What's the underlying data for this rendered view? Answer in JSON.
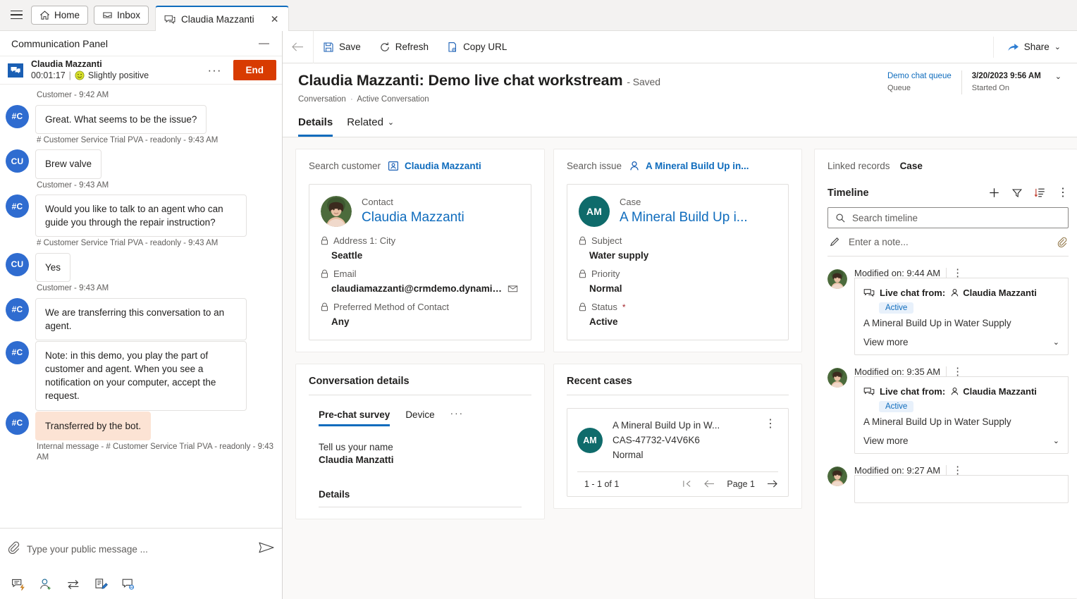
{
  "tabstrip": {
    "menu_icon": "hamburger-icon",
    "tabs": [
      {
        "label": "Home",
        "icon": "home-icon"
      },
      {
        "label": "Inbox",
        "icon": "inbox-icon"
      }
    ],
    "active_tab": {
      "label": "Claudia Mazzanti",
      "icon": "chat-icon",
      "close": "✕"
    }
  },
  "comm_panel": {
    "title": "Communication Panel",
    "minimize": "—",
    "conversation": {
      "name": "Claudia Mazzanti",
      "timer": "00:01:17",
      "separator": "|",
      "sentiment": "Slightly positive",
      "more": "···",
      "end_label": "End"
    },
    "messages": [
      {
        "kind": "stamp",
        "text": "Customer - 9:42 AM"
      },
      {
        "kind": "msg",
        "initials": "#C",
        "text": "Great. What seems to be the issue?",
        "internal": false
      },
      {
        "kind": "stamp",
        "text": "# Customer Service Trial PVA - readonly - 9:43 AM"
      },
      {
        "kind": "msg",
        "initials": "CU",
        "text": "Brew valve",
        "internal": false
      },
      {
        "kind": "stamp",
        "text": "Customer - 9:43 AM"
      },
      {
        "kind": "msg",
        "initials": "#C",
        "text": "Would you like to talk to an agent who can guide you through the repair instruction?",
        "internal": false
      },
      {
        "kind": "stamp",
        "text": "# Customer Service Trial PVA - readonly - 9:43 AM"
      },
      {
        "kind": "msg",
        "initials": "CU",
        "text": "Yes",
        "internal": false
      },
      {
        "kind": "stamp",
        "text": "Customer - 9:43 AM"
      },
      {
        "kind": "msg",
        "initials": "#C",
        "text": "We are transferring this conversation to an agent.",
        "internal": false
      },
      {
        "kind": "msg",
        "initials": "#C",
        "text": "Note: in this demo, you play the part of customer and agent. When you see a notification on your computer, accept the request.",
        "internal": false
      },
      {
        "kind": "msg",
        "initials": "#C",
        "text": "Transferred by the bot.",
        "internal": true
      },
      {
        "kind": "stamp",
        "text": "Internal message - # Customer Service Trial PVA - readonly - 9:43 AM"
      }
    ],
    "composer": {
      "attach_icon": "paperclip-icon",
      "placeholder": "Type your public message ...",
      "value": "",
      "send_icon": "send-icon"
    },
    "tools": [
      "quick-reply-icon",
      "add-agent-icon",
      "transfer-icon",
      "notes-icon",
      "consult-icon"
    ]
  },
  "command_bar": {
    "back_icon": "back-arrow-icon",
    "items": [
      {
        "label": "Save",
        "icon": "save-icon"
      },
      {
        "label": "Refresh",
        "icon": "refresh-icon"
      },
      {
        "label": "Copy URL",
        "icon": "copy-url-icon"
      }
    ],
    "share": {
      "label": "Share",
      "icon": "share-icon",
      "chevron": "⌄"
    }
  },
  "record_header": {
    "title": "Claudia Mazzanti: Demo live chat workstream",
    "saved_state": "- Saved",
    "breadcrumb": {
      "parent": "Conversation",
      "separator": "·",
      "current": "Active Conversation"
    },
    "meta": [
      {
        "value": "Demo chat queue",
        "label": "Queue",
        "link": true
      },
      {
        "value": "3/20/2023 9:56 AM",
        "label": "Started On",
        "link": false
      }
    ],
    "meta_chevron": "⌄",
    "tabs": [
      {
        "label": "Details",
        "active": true
      },
      {
        "label": "Related",
        "active": false,
        "chevron": "⌄"
      }
    ]
  },
  "customer_panel": {
    "search_label": "Search customer",
    "search_value": "Claudia Mazzanti",
    "search_icon": "contact-card-icon",
    "card": {
      "type": "Contact",
      "title": "Claudia Mazzanti",
      "avatar": "photo-avatar",
      "fields": [
        {
          "label": "Address 1: City",
          "value": "Seattle",
          "locked": true
        },
        {
          "label": "Email",
          "value": "claudiamazzanti@crmdemo.dynamics....",
          "locked": true,
          "trailing_icon": "email-icon"
        },
        {
          "label": "Preferred Method of Contact",
          "value": "Any",
          "locked": true
        }
      ]
    }
  },
  "issue_panel": {
    "search_label": "Search issue",
    "search_value": "A Mineral Build Up in...",
    "search_icon": "person-icon",
    "card": {
      "type": "Case",
      "title": "A Mineral Build Up i...",
      "avatar_initials": "AM",
      "fields": [
        {
          "label": "Subject",
          "value": "Water supply",
          "locked": true
        },
        {
          "label": "Priority",
          "value": "Normal",
          "locked": true
        },
        {
          "label": "Status",
          "value": "Active",
          "locked": true,
          "required": true
        }
      ]
    }
  },
  "conversation_details": {
    "title": "Conversation details",
    "tabs": [
      {
        "label": "Pre-chat survey",
        "active": true
      },
      {
        "label": "Device",
        "active": false
      },
      {
        "label": "···",
        "active": false,
        "overflow": true
      }
    ],
    "survey": {
      "question": "Tell us your name",
      "answer": "Claudia Manzatti"
    },
    "section_title": "Details"
  },
  "recent_cases": {
    "title": "Recent cases",
    "items": [
      {
        "avatar_initials": "AM",
        "title": "A Mineral Build Up in W...",
        "number": "CAS-47732-V4V6K6",
        "priority": "Normal",
        "kebab": "⋮"
      }
    ],
    "pager": {
      "count": "1 - 1 of 1",
      "first_icon": "first-page-icon",
      "prev_icon": "prev-page-icon",
      "page_label": "Page 1",
      "next_icon": "next-page-icon"
    }
  },
  "timeline_panel": {
    "linked_records_label": "Linked records",
    "linked_records_value": "Case",
    "title": "Timeline",
    "actions": [
      {
        "name": "add-record-icon",
        "glyph": "+"
      },
      {
        "name": "filter-icon",
        "glyph": "filter"
      },
      {
        "name": "sort-icon",
        "glyph": "sort"
      },
      {
        "name": "more-commands-icon",
        "glyph": "⋮"
      }
    ],
    "search_placeholder": "Search timeline",
    "search_value": "",
    "note_placeholder": "Enter a note...",
    "note_attach_icon": "paperclip-icon",
    "entries": [
      {
        "modified_label": "Modified on: 9:44 AM",
        "kebab": "⋮",
        "channel_icon": "chat-icon",
        "from_label": "Live chat from:",
        "from_name": "Claudia Mazzanti",
        "status_badge": "Active",
        "description": "A Mineral Build Up in Water Supply",
        "view_more": "View more",
        "view_more_chevron": "⌄"
      },
      {
        "modified_label": "Modified on: 9:35 AM",
        "kebab": "⋮",
        "channel_icon": "chat-icon",
        "from_label": "Live chat from:",
        "from_name": "Claudia Mazzanti",
        "status_badge": "Active",
        "description": "A Mineral Build Up in Water Supply",
        "view_more": "View more",
        "view_more_chevron": "⌄"
      },
      {
        "modified_label": "Modified on: 9:27 AM",
        "kebab": "⋮",
        "channel_icon": "chat-icon",
        "from_label": "",
        "from_name": "",
        "status_badge": "",
        "description": "",
        "view_more": "",
        "view_more_chevron": ""
      }
    ]
  },
  "colors": {
    "accent": "#0f6cbd",
    "end_button": "#d83b01",
    "avatar_blue": "#2f6cd0",
    "case_teal": "#0f6b6b",
    "internal_msg": "#fce3d4",
    "badge_bg": "#e8f1fb"
  }
}
